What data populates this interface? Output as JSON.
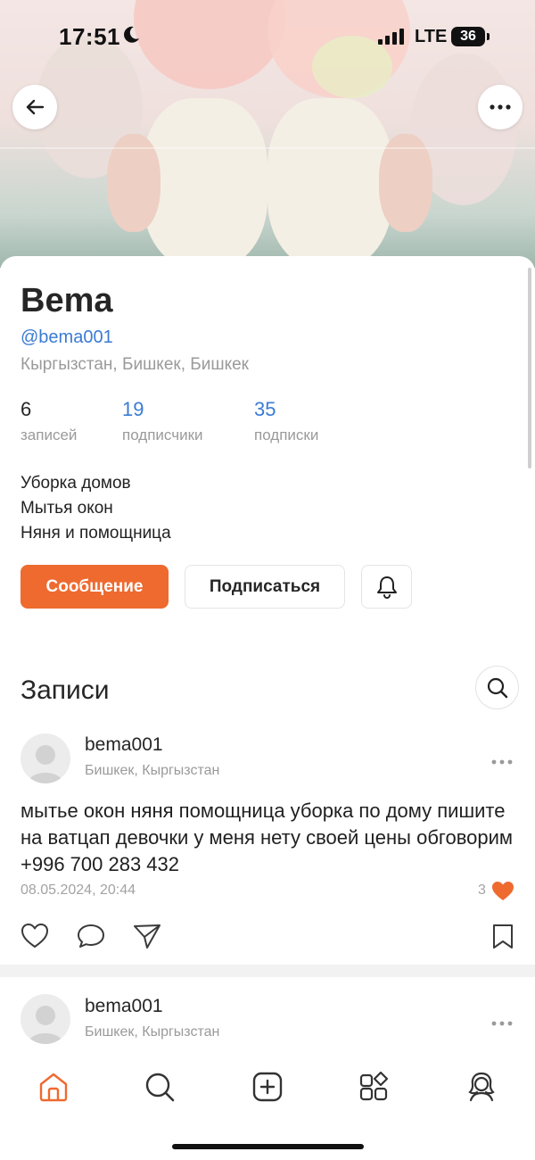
{
  "status_bar": {
    "time": "17:51",
    "network": "LTE",
    "battery": "36"
  },
  "profile": {
    "name": "Bema",
    "handle": "@bema001",
    "location": "Кыргызстан, Бишкек, Бишкек",
    "stats": [
      {
        "value": "6",
        "label": "записей"
      },
      {
        "value": "19",
        "label": "подписчики"
      },
      {
        "value": "35",
        "label": "подписки"
      }
    ],
    "bio": [
      "Уборка домов",
      "Мытья окон",
      "Няня и помощница"
    ],
    "message_button": "Сообщение",
    "subscribe_button": "Подписаться"
  },
  "posts_section": {
    "title": "Записи"
  },
  "posts": [
    {
      "author": "bema001",
      "location": "Бишкек, Кыргызстан",
      "text": "мытье окон няня помощница уборка по дому пишите на ватцап девочки у меня нету своей цены обговорим +996 700 283 432",
      "date": "08.05.2024, 20:44",
      "likes": "3"
    },
    {
      "author": "bema001",
      "location": "Бишкек, Кыргызстан"
    }
  ],
  "icons": {
    "back": "arrow-left-icon",
    "more": "ellipsis-icon",
    "bell": "bell-icon",
    "search": "search-icon",
    "like": "heart-icon",
    "comment": "comment-icon",
    "share": "send-icon",
    "bookmark": "bookmark-icon",
    "tabs": [
      "home-icon",
      "search-icon",
      "add-icon",
      "services-icon",
      "profile-icon"
    ]
  },
  "colors": {
    "accent": "#ee6a2f",
    "link": "#3a7bd5",
    "muted": "#9a9a9a"
  }
}
